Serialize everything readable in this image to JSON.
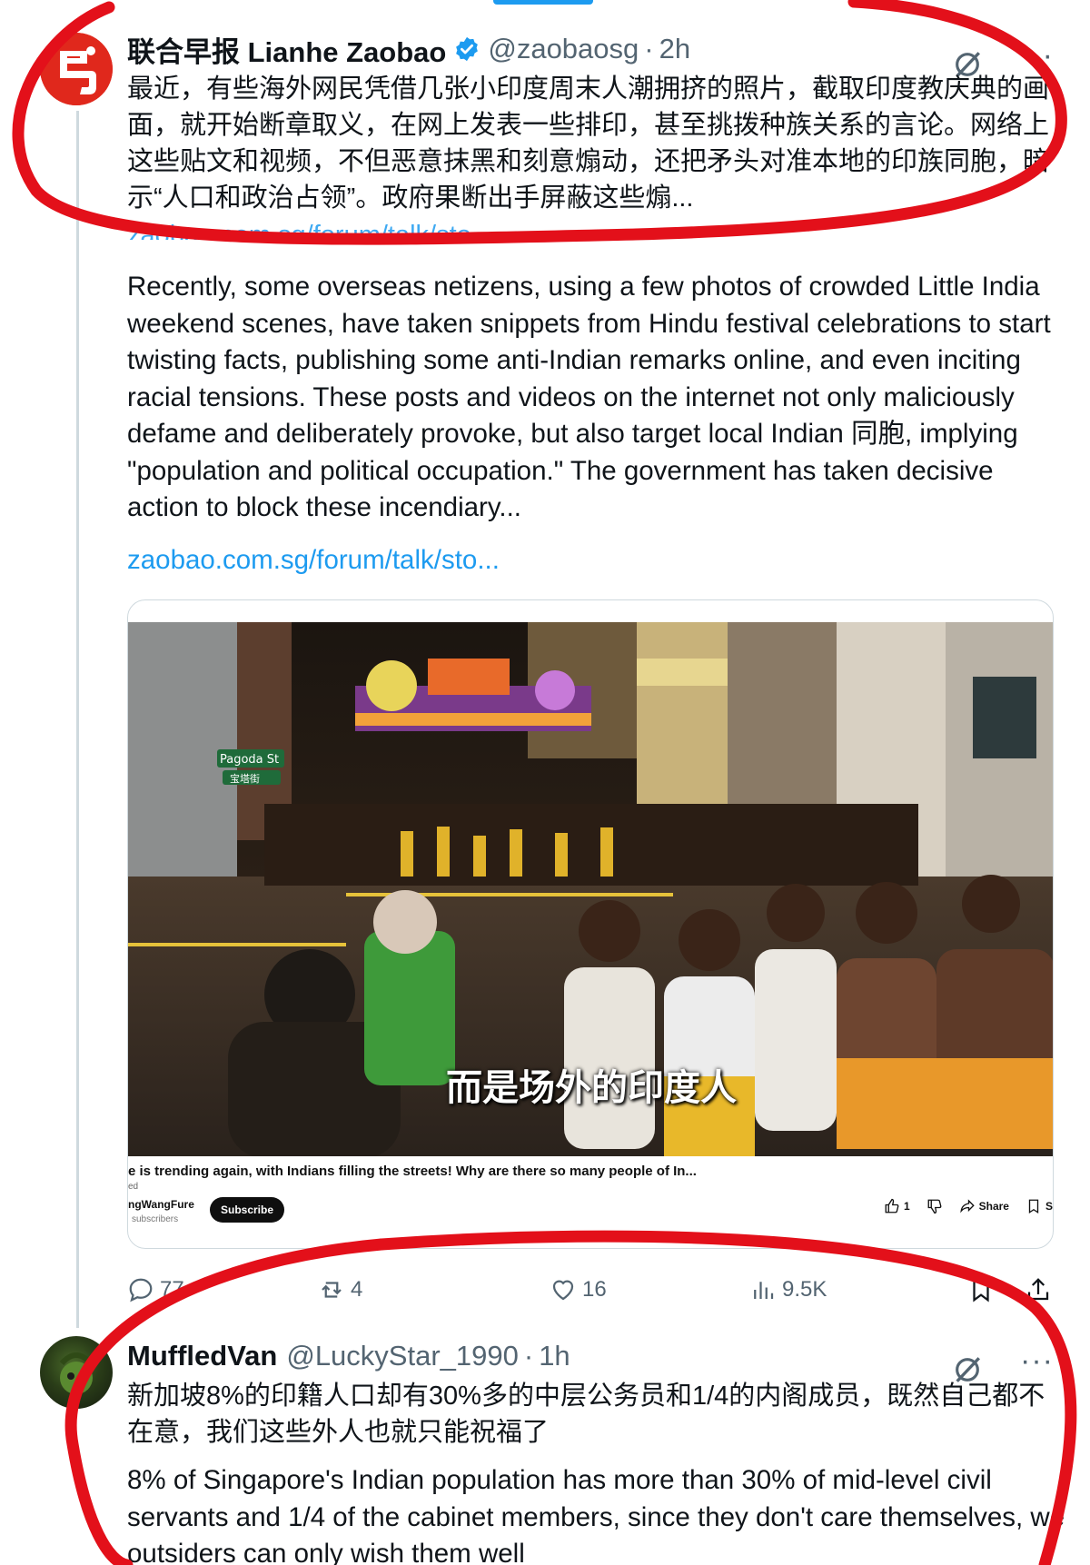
{
  "tweets": [
    {
      "display_name": "联合早报 Lianhe Zaobao",
      "handle": "@zaobaosg",
      "time": "2h",
      "text_zh": "最近，有些海外网民凭借几张小印度周末人潮拥挤的照片，截取印度教庆典的画面，就开始断章取义，在网上发表一些排印，甚至挑拨种族关系的言论。网络上这些贴文和视频，不但恶意抹黑和刻意煽动，还把矛头对准本地的印族同胞，暗示“人口和政治占领”。政府果断出手屏蔽这些煽...",
      "link_strip": "zaobao.com.sg/forum/talk/sto...",
      "text_en": "Recently, some overseas netizens, using a few photos of crowded Little India weekend scenes, have taken snippets from Hindu festival celebrations to start twisting facts, publishing some anti-Indian remarks online, and even inciting racial tensions. These posts and videos on the internet not only maliciously defame and deliberately provoke, but also target local Indian 同胞, implying \"population and political occupation.\" The government has taken decisive action to block these incendiary...",
      "link": "zaobao.com.sg/forum/talk/sto...",
      "media": {
        "street_sign_1": "Pagoda St",
        "street_sign_2": "宝塔街",
        "caption": "而是场外的印度人",
        "video_title": "e is trending again, with Indians filling the streets! Why are there so many people of In...",
        "video_sub": "ed",
        "channel": "ngWangFure",
        "subscribers": "subscribers",
        "subscribe_label": "Subscribe",
        "likes": "1",
        "share_label": "Share",
        "save_label": "S"
      },
      "metrics": {
        "replies": "77",
        "reposts": "4",
        "likes": "16",
        "views": "9.5K"
      }
    },
    {
      "display_name": "MuffledVan",
      "handle": "@LuckyStar_1990",
      "time": "1h",
      "text_zh": "新加坡8%的印籍人口却有30%多的中层公务员和1/4的内阁成员，既然自己都不在意，我们这些外人也就只能祝福了",
      "text_en": "8% of Singapore's Indian population has more than 30% of mid-level civil servants and 1/4 of the cabinet members, since they don't care themselves, we outsiders can only wish them well"
    }
  ],
  "colors": {
    "brand_blue": "#1d9bf0",
    "secondary_text": "#536471",
    "annotation_red": "#e3101a",
    "zaobao_red": "#e0281c"
  },
  "icons": [
    "grok-icon",
    "more-icon",
    "verified-badge-icon",
    "reply-icon",
    "repost-icon",
    "like-icon",
    "views-icon",
    "bookmark-icon",
    "share-icon"
  ]
}
